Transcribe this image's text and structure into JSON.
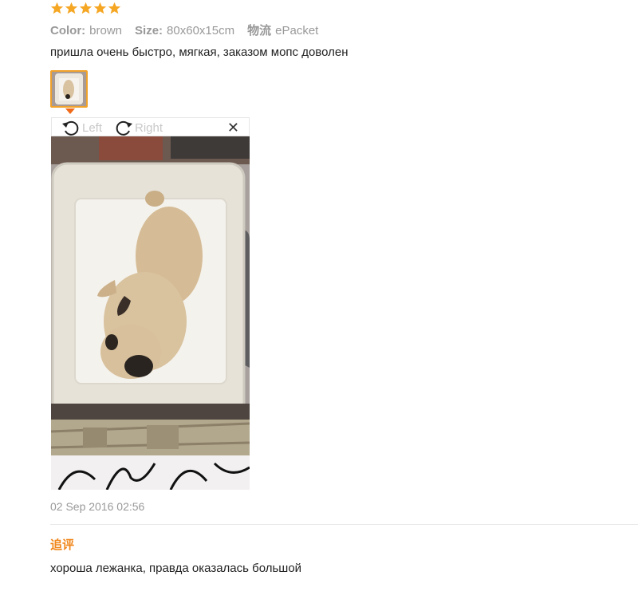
{
  "review": {
    "rating": 5,
    "star_color": "#f5a623",
    "color_label": "Color:",
    "color_value": "brown",
    "size_label": "Size:",
    "size_value": "80x60x15cm",
    "shipping_label": "物流",
    "shipping_value": "ePacket",
    "text": "пришла очень быстро, мягкая, заказом мопс доволен",
    "date": "02 Sep 2016 02:56"
  },
  "viewer": {
    "rotate_left_label": "Left",
    "rotate_right_label": "Right",
    "close_icon": "close-icon"
  },
  "followup": {
    "label": "追评",
    "text": "хороша лежанка, правда оказалась большой"
  },
  "colors": {
    "accent": "#f0a22a",
    "followup_label": "#f0861a"
  }
}
